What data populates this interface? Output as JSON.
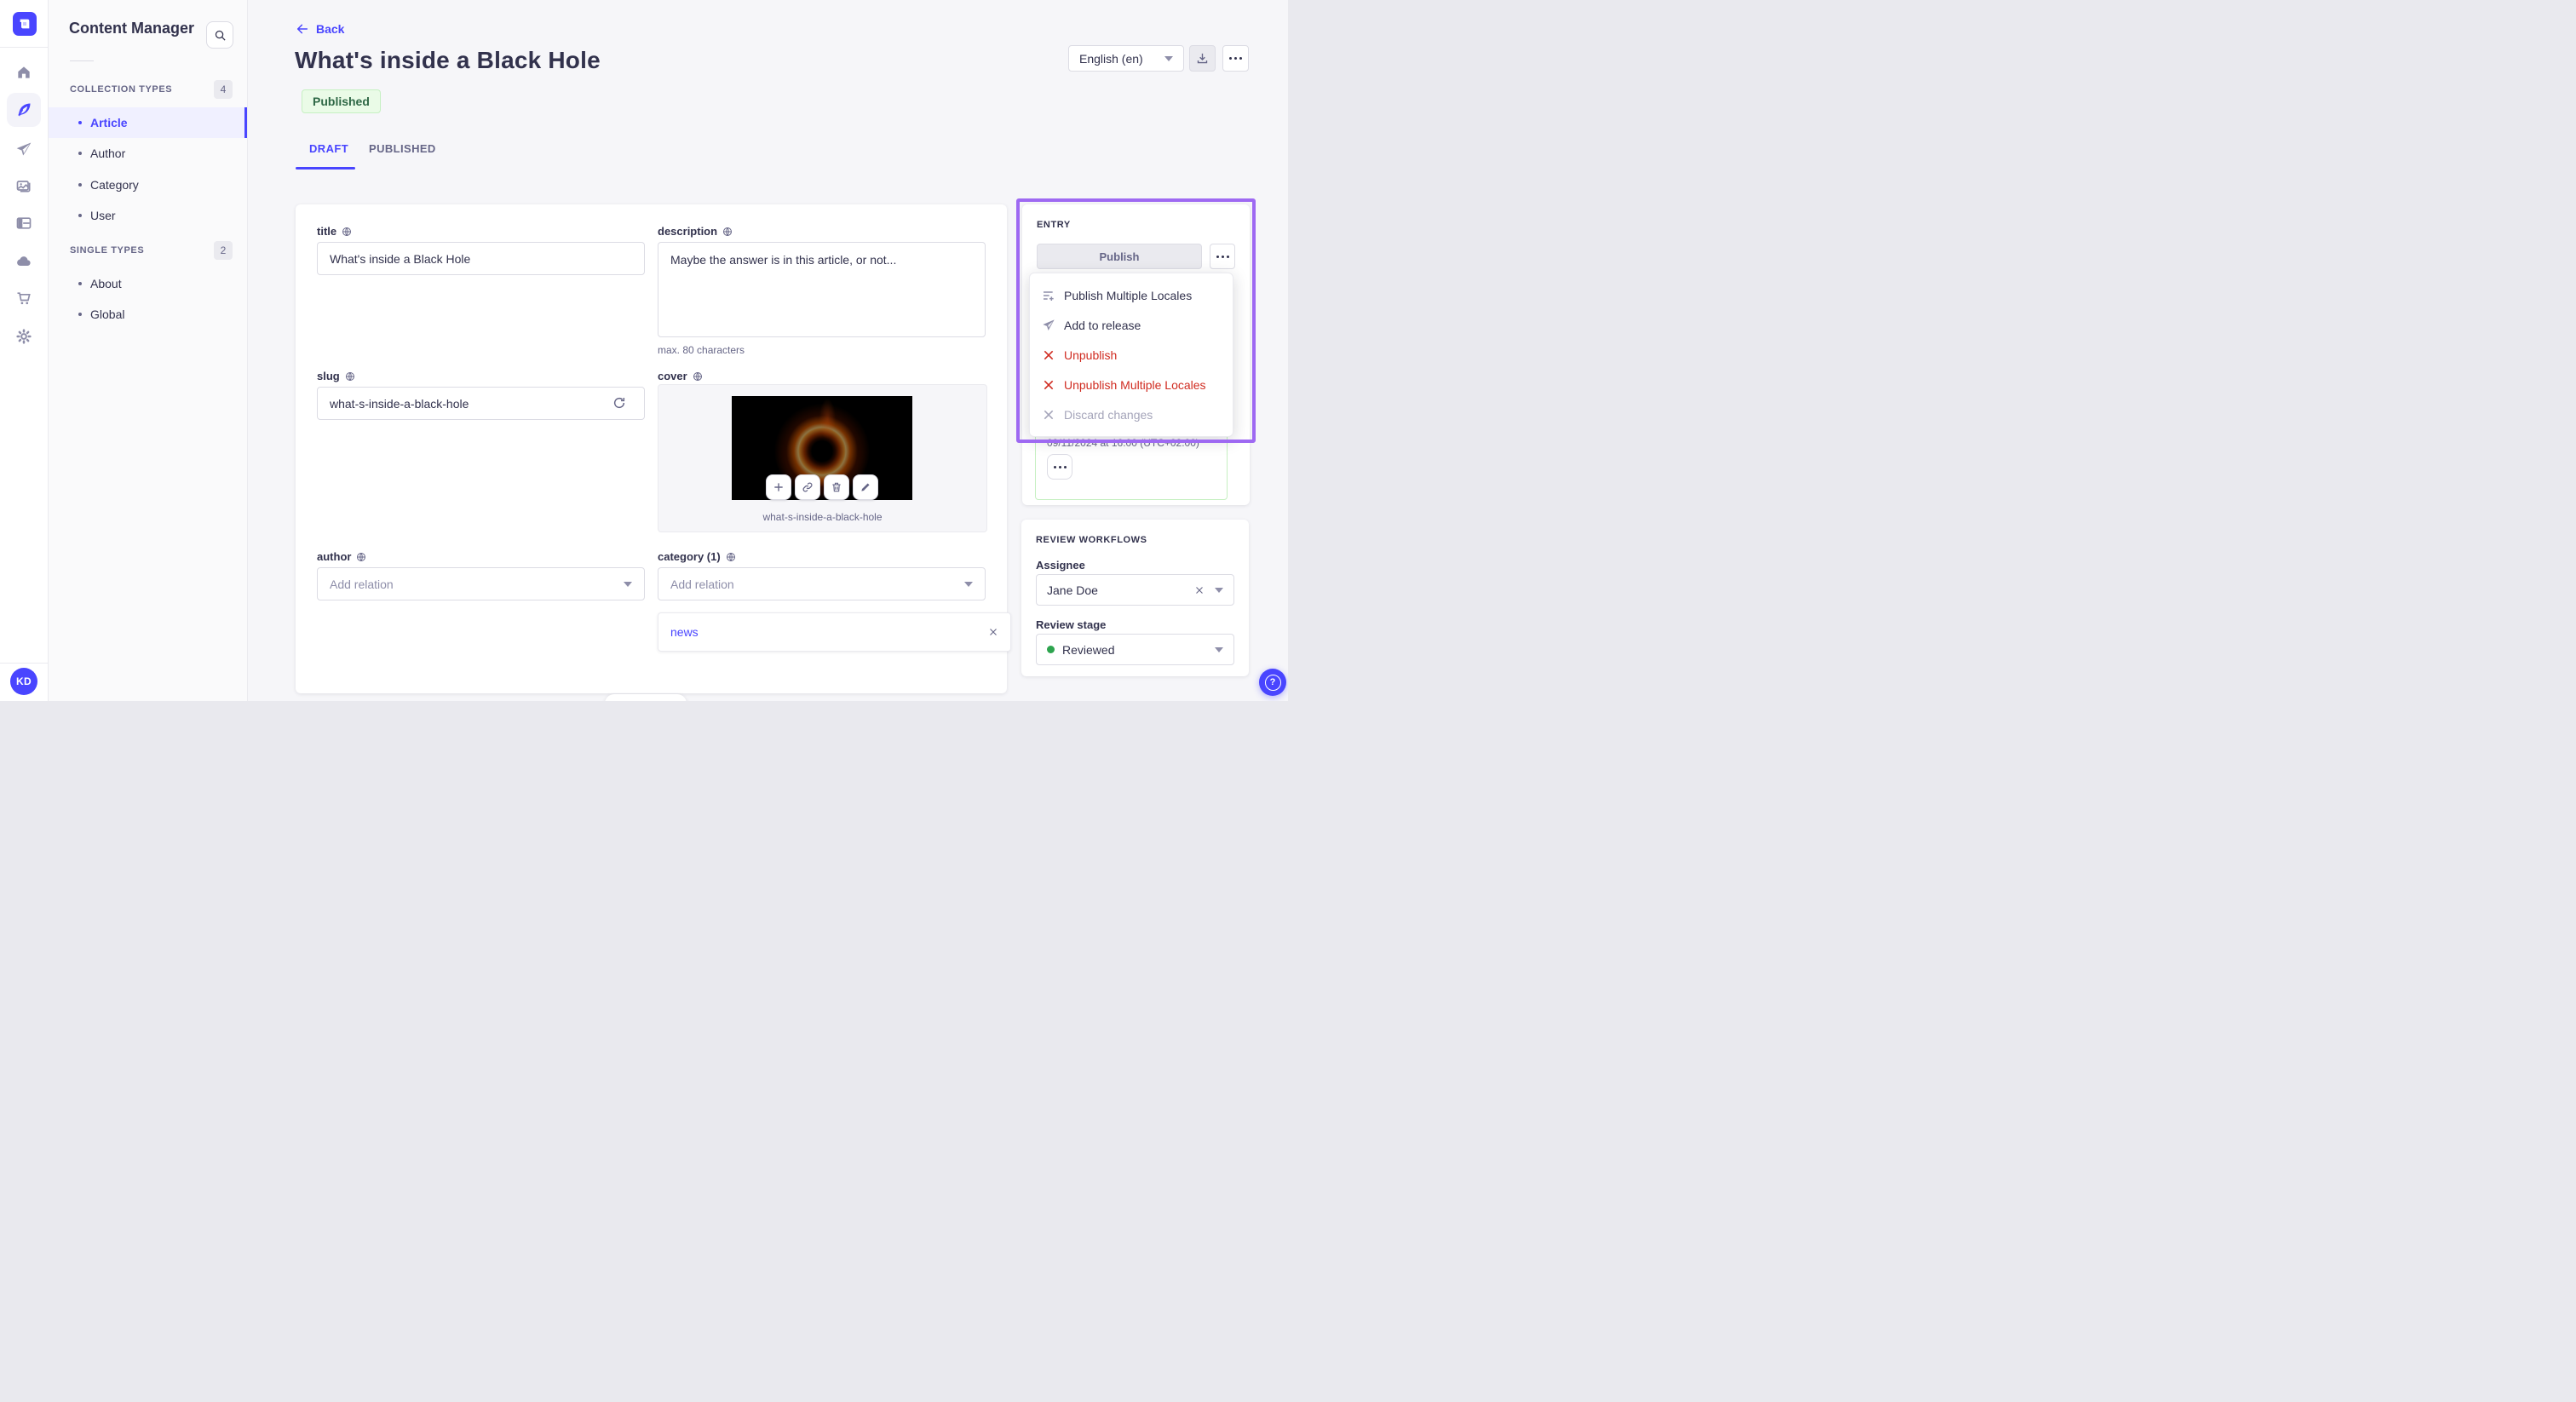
{
  "colors": {
    "accent": "#4945ff",
    "tour_highlight": "#9e69f2",
    "danger": "#d02b20",
    "success_text": "#2f6846",
    "success_bg": "#eafbe7",
    "success_border": "#c6f0c2",
    "page_bg": "#f6f6f9"
  },
  "sidebar": {
    "user_initials": "KD"
  },
  "subnav": {
    "title": "Content Manager",
    "sections": [
      {
        "label": "COLLECTION TYPES",
        "count": "4",
        "items": [
          {
            "label": "Article"
          },
          {
            "label": "Author"
          },
          {
            "label": "Category"
          },
          {
            "label": "User"
          }
        ]
      },
      {
        "label": "SINGLE TYPES",
        "count": "2",
        "items": [
          {
            "label": "About"
          },
          {
            "label": "Global"
          }
        ]
      }
    ]
  },
  "header": {
    "back": "Back",
    "title": "What's inside a Black Hole",
    "status": "Published",
    "locale": "English (en)"
  },
  "tabs": {
    "draft": "DRAFT",
    "published": "PUBLISHED"
  },
  "form": {
    "title": {
      "label": "title",
      "value": "What's inside a Black Hole"
    },
    "description": {
      "label": "description",
      "value": "Maybe the answer is in this article, or not...",
      "hint": "max. 80 characters"
    },
    "slug": {
      "label": "slug",
      "value": "what-s-inside-a-black-hole"
    },
    "cover": {
      "label": "cover",
      "filename": "what-s-inside-a-black-hole"
    },
    "author": {
      "label": "author",
      "placeholder": "Add relation"
    },
    "category": {
      "label": "category (1)",
      "placeholder": "Add relation",
      "relations": [
        {
          "label": "news"
        }
      ]
    }
  },
  "entry": {
    "heading": "ENTRY",
    "publish_label": "Publish",
    "menu": [
      {
        "label": "Publish Multiple Locales"
      },
      {
        "label": "Add to release"
      },
      {
        "label": "Unpublish"
      },
      {
        "label": "Unpublish Multiple Locales"
      },
      {
        "label": "Discard changes"
      }
    ],
    "release_date": "09/11/2024 at 16:00 (UTC+02:00)"
  },
  "review": {
    "heading": "REVIEW WORKFLOWS",
    "assignee_label": "Assignee",
    "assignee_value": "Jane Doe",
    "stage_label": "Review stage",
    "stage_value": "Reviewed"
  }
}
